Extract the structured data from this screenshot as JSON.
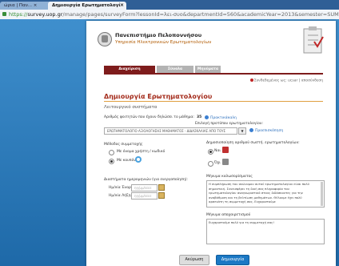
{
  "browser": {
    "tab1_label": "ώρια | Παν... ×",
    "tab2_label": "Δημιουργία Ερωτηματολογί",
    "url_proto": "https://",
    "url_host": "survey.uop.gr",
    "url_path": "/manage/pages/surveyForm?lessonId=λει-συο&departmentId=560&academicYear=2013&semester=SUM"
  },
  "header": {
    "university": "Πανεπιστήμιο Πελοποννήσου",
    "service": "Υπηρεσία Ηλεκτρονικών Ερωτηματολογίων"
  },
  "menu": [
    "Διαχείριση Ερωτηματολογίων",
    "Σύνολα Ερωτήσεων",
    "Μηνύματα"
  ],
  "userline": "Συνδεδεμένος ως: ucsar  |  αποσύνδεση",
  "page_title": "Δημιουργία Ερωτηματολογίου",
  "section": "Λειτουργικό συστήματα",
  "fields": {
    "count_label": "Αριθμός φοιτητών που έχουν δηλώσει το μάθημα:",
    "count_value": "35",
    "info_link": "Πρακτικάκαλη",
    "template_label": "Επιλογή προτύπου ερωτηματολογίου:",
    "template_value": "ΕΡΩΤΗΜΑΤΟΛΟΓΙΟ ΑΞΙΟΛΟΓΗΣΗΣ ΜΑΘΗΜΑΤΟΣ - ΔΙΔΑΣΚΑΛΙΑΣ ΑΠΟ ΤΟΥΣ",
    "preview_link": "Προεπισκόπηση"
  },
  "method": {
    "label": "Μέθοδος συμμετοχής",
    "opt1": "Με όνομα χρήστη / κωδικό",
    "opt2": "Με κουπόνι"
  },
  "publish": {
    "label": "Δημοσιοποίηση αριθμού σωστή. ερωτηματολογίων:",
    "yes": "Ναι",
    "no": "Όχι"
  },
  "dates": {
    "label": "Διαστήματα ημερομηνιών (για ενεργοποίηση):",
    "start": "Ημ/νία Έναρξης",
    "end": "Ημ/νία Λήξης",
    "placeholder": "ηη/μμ/εεεε"
  },
  "welcome": {
    "label": "Μήνυμα καλωσορίσματος",
    "text": "Η συμπλήρωση του ανώνυμου αυτού ερωτηματολογίου είναι πολύ σημαντική. Συνεισφέρει τη δική σας πληροφορία του ερωτηματολογίου αναγνωριστικό στους διδάσκοντες για την αναβάθμιση και τη βελτίωση μαθημάτων. Θέλουμε έχει πολύ αρσενάτη τη συμμετοχή σας. Ευχαριστούμε"
  },
  "thanks": {
    "label": "Μήνυμα αποχαιρετισμού",
    "text": "Ευχαριστούμε πολύ για τη συμμετοχή σας!"
  },
  "buttons": {
    "cancel": "Ακύρωση",
    "create": "Δημιουργία"
  }
}
